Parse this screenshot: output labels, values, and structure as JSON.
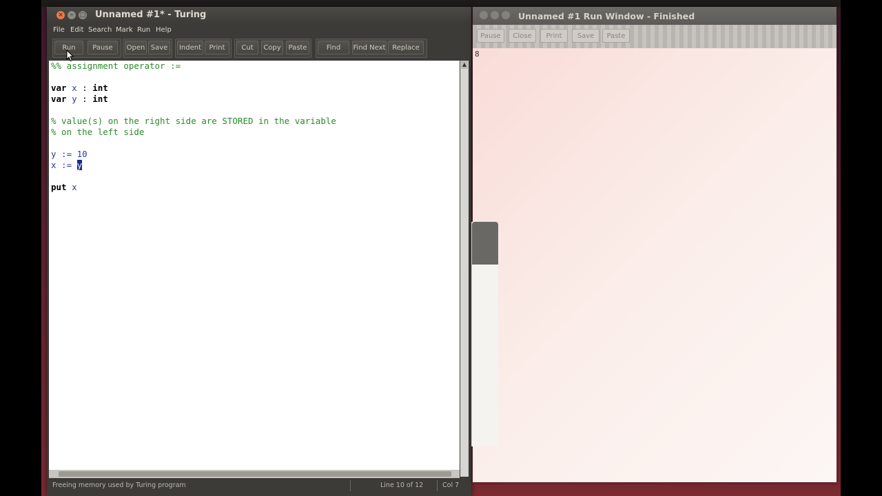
{
  "editor": {
    "title": "Unnamed #1* - Turing",
    "menu": [
      "File",
      "Edit",
      "Search",
      "Mark",
      "Run",
      "Help"
    ],
    "toolbar": [
      "Run",
      "Pause",
      "Open",
      "Save",
      "Indent",
      "Print",
      "Cut",
      "Copy",
      "Paste",
      "Find",
      "Find Next",
      "Replace"
    ],
    "code": {
      "l1": "%% assignment operator :=",
      "l3_kw": "var",
      "l3_id": "x",
      "l3_rest": " : ",
      "l3_type": "int",
      "l4_kw": "var",
      "l4_id": "y",
      "l4_rest": " : ",
      "l4_type": "int",
      "l6": "% value(s) on the right side are STORED in the variable",
      "l7": "% on the left side",
      "l9": "y := 10",
      "l10_pre": "x := ",
      "l10_sel": "y",
      "l12_kw": "put",
      "l12_id": "x"
    },
    "status": {
      "message": "Freeing memory used by Turing program",
      "line": "Line 10 of 12",
      "col": "Col 7"
    }
  },
  "run_window": {
    "title": "Unnamed #1 Run Window - Finished",
    "toolbar": [
      "Pause",
      "Close",
      "Print",
      "Save",
      "Paste"
    ],
    "output": "8"
  }
}
